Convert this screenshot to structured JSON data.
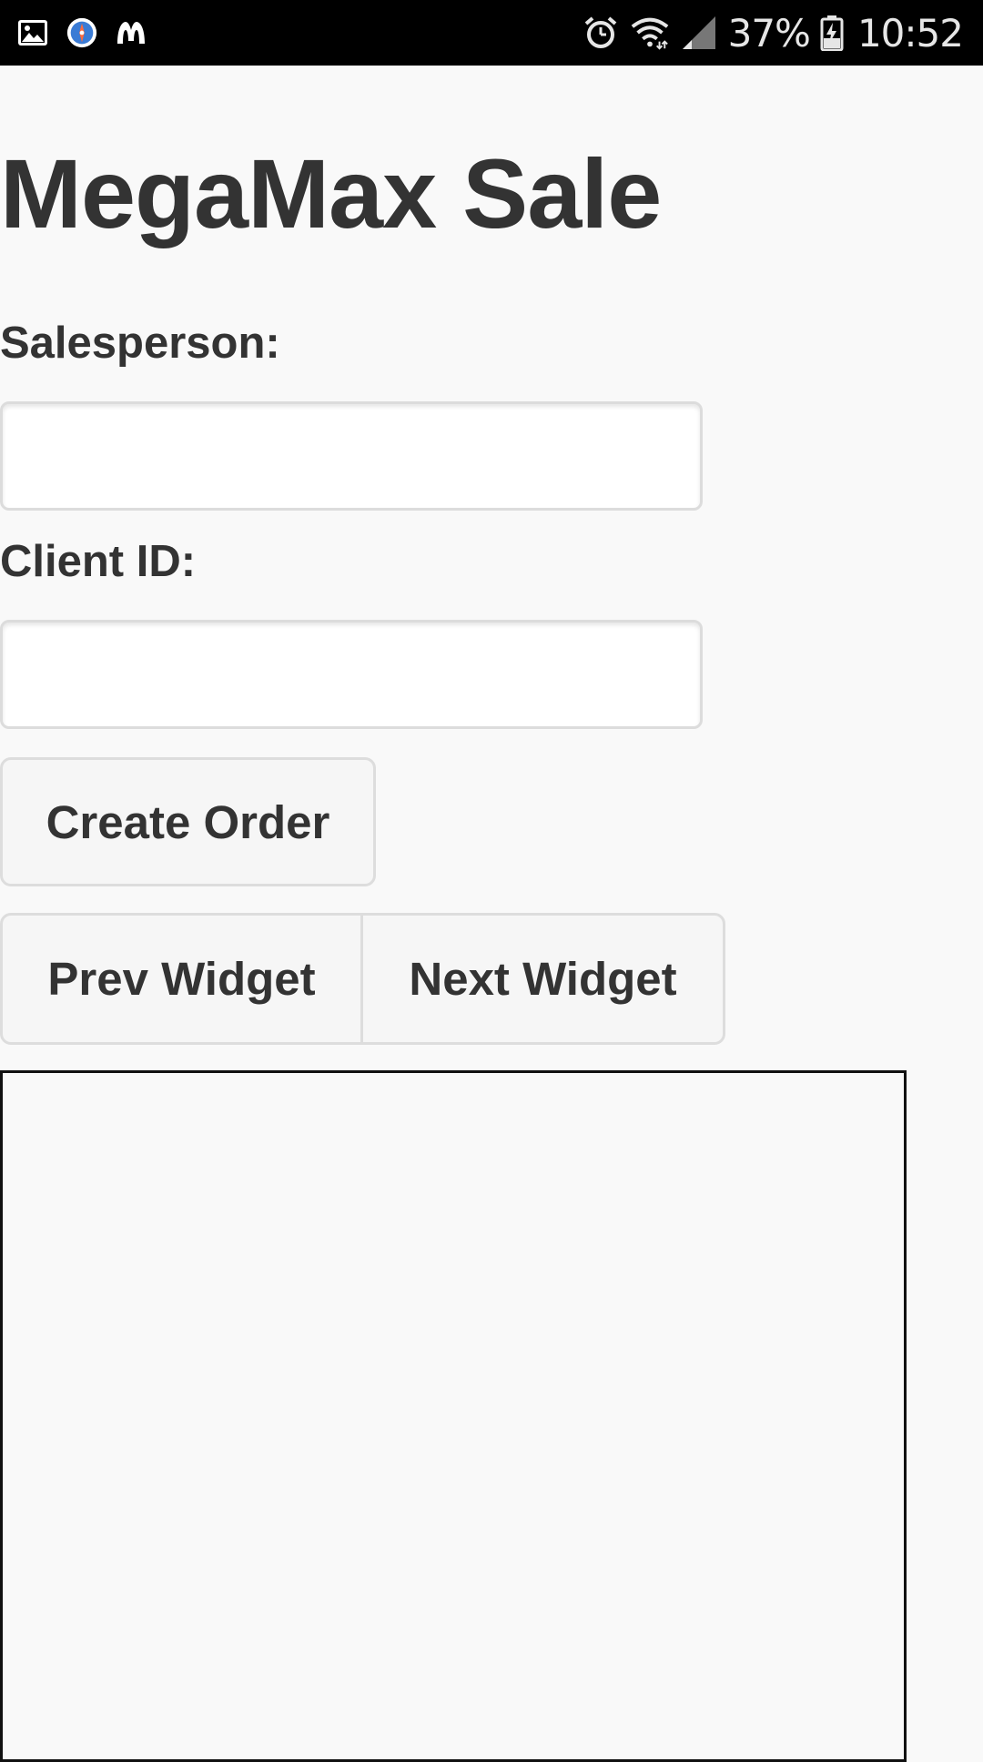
{
  "status_bar": {
    "left_icons": [
      "gallery-icon",
      "compass-icon",
      "m-logo-icon"
    ],
    "alarm_icon": "alarm-clock-icon",
    "wifi_icon": "wifi-icon",
    "signal_icon": "cell-signal-icon",
    "battery_percent": "37%",
    "battery_icon": "battery-charging-icon",
    "time": "10:52"
  },
  "page": {
    "title": "MegaMax Sale"
  },
  "form": {
    "salesperson": {
      "label": "Salesperson:",
      "value": "",
      "placeholder": ""
    },
    "client_id": {
      "label": "Client ID:",
      "value": "",
      "placeholder": ""
    },
    "create_order_label": "Create Order"
  },
  "widget_nav": {
    "prev_label": "Prev Widget",
    "next_label": "Next Widget"
  },
  "colors": {
    "background": "#f9f9f9",
    "text": "#333333",
    "status_bar": "#000000",
    "button_bg": "#f6f6f6",
    "border": "#dddddd"
  }
}
